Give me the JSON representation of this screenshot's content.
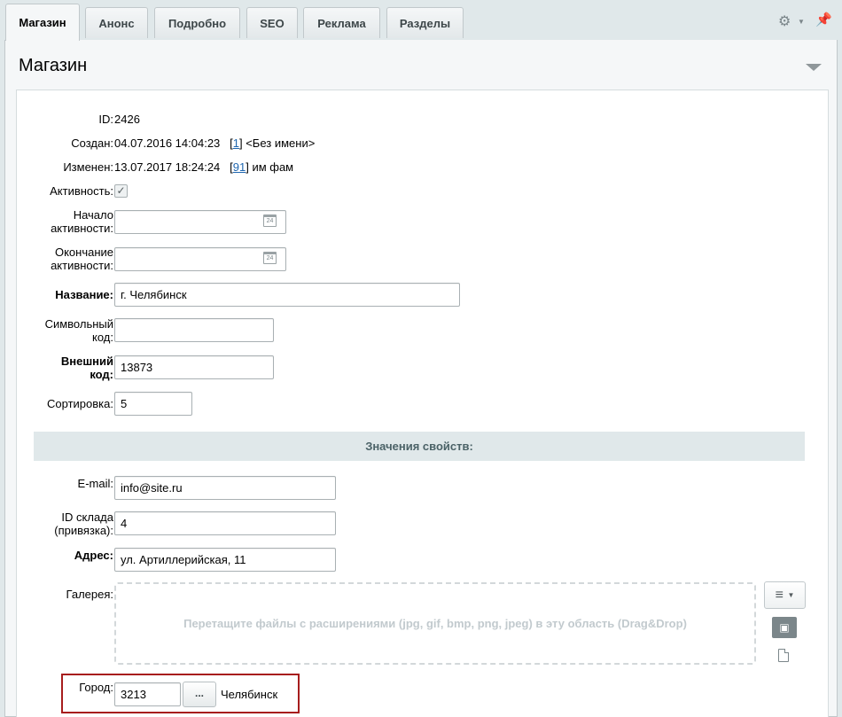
{
  "tabs": [
    {
      "label": "Магазин",
      "active": true
    },
    {
      "label": "Анонс"
    },
    {
      "label": "Подробно"
    },
    {
      "label": "SEO"
    },
    {
      "label": "Реклама"
    },
    {
      "label": "Разделы"
    }
  ],
  "section": {
    "title": "Магазин"
  },
  "fields": {
    "id": {
      "label": "ID:",
      "value": "2426"
    },
    "created": {
      "label": "Создан:",
      "date": "04.07.2016 14:04:23",
      "user_link": "1",
      "user_name": "<Без имени>"
    },
    "modified": {
      "label": "Изменен:",
      "date": "13.07.2017 18:24:24",
      "user_link": "91",
      "user_name": "им фам"
    },
    "active": {
      "label": "Активность:",
      "checked": true
    },
    "active_from": {
      "label_1": "Начало",
      "label_2": "активности:",
      "value": ""
    },
    "active_to": {
      "label_1": "Окончание",
      "label_2": "активности:",
      "value": ""
    },
    "name": {
      "label": "Название:",
      "value": "г. Челябинск"
    },
    "code": {
      "label_1": "Символьный",
      "label_2": "код:",
      "value": ""
    },
    "xml_id": {
      "label_1": "Внешний",
      "label_2": "код:",
      "value": "13873"
    },
    "sort": {
      "label": "Сортировка:",
      "value": "5"
    }
  },
  "properties": {
    "header": "Значения свойств:",
    "email": {
      "label": "E-mail:",
      "value": "info@site.ru"
    },
    "store_id": {
      "label_1": "ID склада",
      "label_2": "(привязка):",
      "value": "4"
    },
    "address": {
      "label": "Адрес:",
      "value": "ул. Артиллерийская, 11"
    },
    "gallery": {
      "label": "Галерея:",
      "drop_text": "Перетащите файлы с расширениями (jpg, gif, bmp, png, jpeg) в эту область (Drag&Drop)"
    },
    "city": {
      "label": "Город:",
      "value": "3213",
      "button_label": "...",
      "name": "Челябинск"
    }
  },
  "colors": {
    "link": "#2067b0",
    "highlight_border": "#a71d1d",
    "header_bg": "#e0e8ea"
  },
  "icons": {
    "settings": "gear-icon",
    "pin": "pin-icon",
    "calendar": "calendar-icon",
    "collapse": "triangle-down-icon",
    "menu": "hamburger-icon",
    "image": "image-icon",
    "file": "file-icon"
  }
}
